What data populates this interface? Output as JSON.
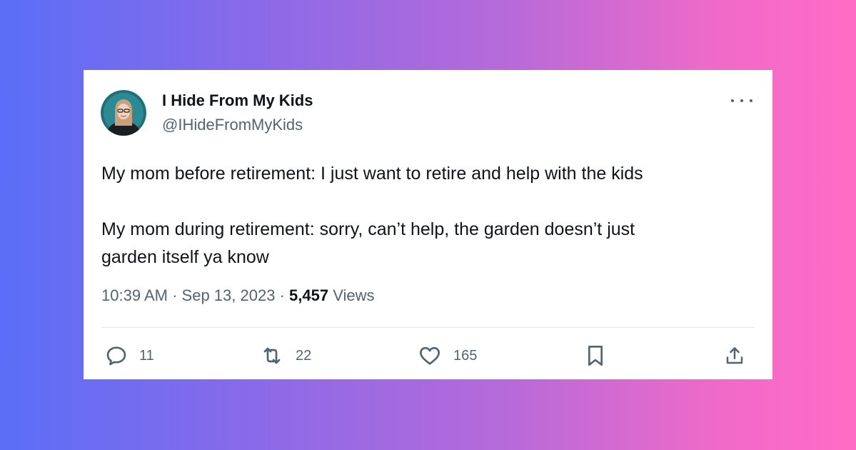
{
  "tweet": {
    "display_name": "I Hide From My Kids",
    "handle": "@IHideFromMyKids",
    "text_para1": "My mom before retirement: I just want to retire and help with the kids",
    "text_para2_line1": "My mom during retirement: sorry, can’t help, the garden doesn’t just",
    "text_para2_line2": "garden itself ya know",
    "time": "10:39 AM",
    "date": "Sep 13, 2023",
    "separator": "·",
    "views_count": "5,457",
    "views_label": "Views"
  },
  "actions": {
    "reply_count": "11",
    "retweet_count": "22",
    "like_count": "165"
  },
  "icons": {
    "more": "more-horizontal-icon",
    "reply": "reply-icon",
    "retweet": "retweet-icon",
    "like": "heart-icon",
    "bookmark": "bookmark-icon",
    "share": "share-icon"
  },
  "colors": {
    "text_primary": "#0f1419",
    "text_secondary": "#536471",
    "background_gradient_start": "#5a6ef7",
    "background_gradient_end": "#ff6cc6"
  }
}
